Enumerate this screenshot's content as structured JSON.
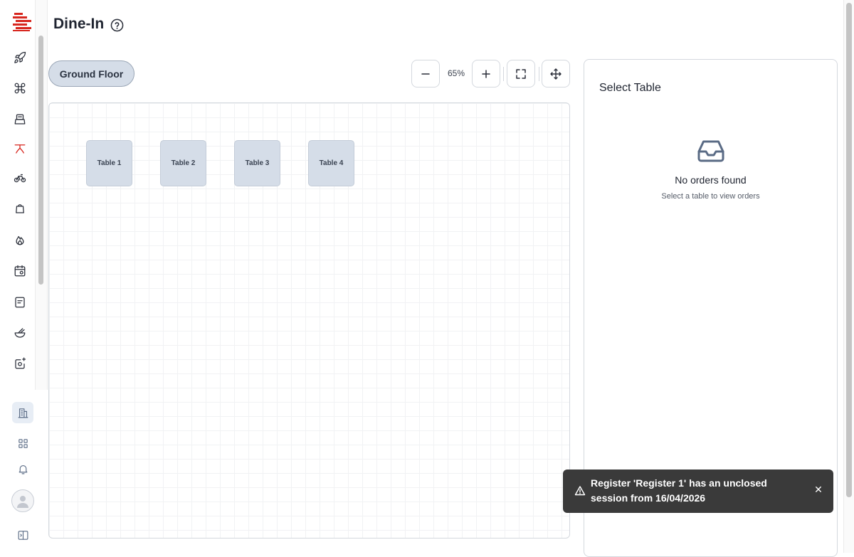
{
  "header": {
    "title": "Dine-In"
  },
  "floors": [
    {
      "label": "Ground Floor"
    }
  ],
  "zoom": {
    "level": "65%"
  },
  "tables": [
    {
      "label": "Table 1"
    },
    {
      "label": "Table 2"
    },
    {
      "label": "Table 3"
    },
    {
      "label": "Table 4"
    }
  ],
  "panel": {
    "title": "Select Table",
    "empty_title": "No orders found",
    "empty_subtitle": "Select a table to view orders"
  },
  "toast": {
    "message": "Register 'Register 1' has an unclosed session from 16/04/2026",
    "close_glyph": "✕"
  },
  "sidebar": {
    "icons": [
      "rocket-icon",
      "command-icon",
      "cash-register-icon",
      "table-icon",
      "bicycle-icon",
      "shopping-bag-icon",
      "flame-icon",
      "calendar-settings-icon",
      "receipt-icon",
      "bowl-icon",
      "add-image-icon"
    ],
    "bottom_icons": [
      "building-icon",
      "grid-icon",
      "bell-icon",
      "avatar",
      "panel-toggle-icon"
    ],
    "accent": "#d7261e"
  }
}
